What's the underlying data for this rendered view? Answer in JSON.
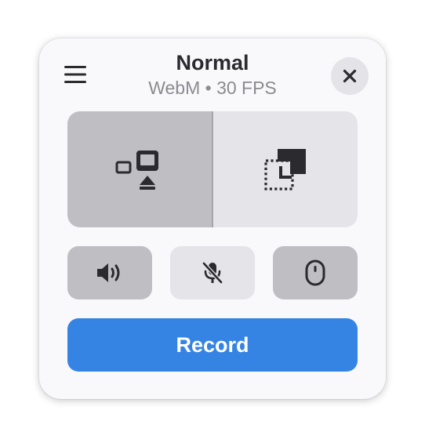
{
  "header": {
    "title": "Normal",
    "subtitle": "WebM • 30 FPS"
  },
  "icons": {
    "menu": "hamburger-menu-icon",
    "close": "close-icon",
    "selection_mode_screen": "screen-cast-icon",
    "selection_mode_window": "window-region-icon",
    "desktop_audio": "speaker-icon",
    "microphone": "microphone-muted-icon",
    "pointer": "mouse-pointer-icon"
  },
  "modes": {
    "selected": "screen"
  },
  "toggles": {
    "desktop_audio": true,
    "microphone": false,
    "pointer": true
  },
  "actions": {
    "record_label": "Record"
  },
  "colors": {
    "accent": "#3584e4",
    "window_bg": "#f9f8fb",
    "active_toggle": "#bfbec3",
    "inactive_toggle": "#e5e4e8",
    "icon": "#2b2b2f"
  }
}
